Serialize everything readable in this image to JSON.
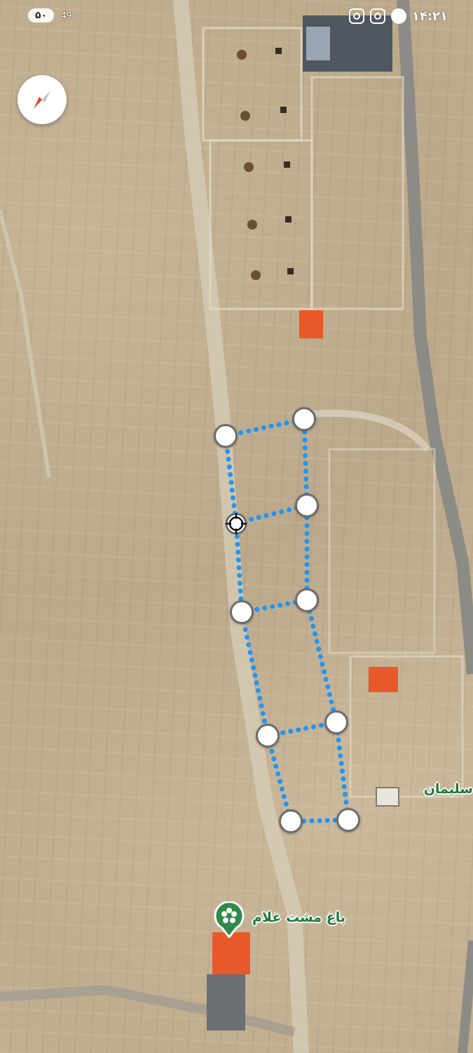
{
  "status_bar": {
    "battery": "۵۰",
    "signal_text": "49",
    "time": "۱۴:۲۱",
    "icons": [
      "instagram-icon",
      "instagram-icon",
      "message-icon"
    ]
  },
  "map": {
    "type": "satellite",
    "compass_icon": "compass-icon",
    "labels": {
      "garden": "باغ مشت غلام",
      "right_edge": "سلیمان"
    },
    "poi_icon": "flower-pin-icon",
    "colors": {
      "path": "#2196f3",
      "handle_fill": "#ffffff",
      "handle_border": "#6d6d6d",
      "label_text": "#1f7a3c",
      "roof": "#e8582a"
    }
  }
}
